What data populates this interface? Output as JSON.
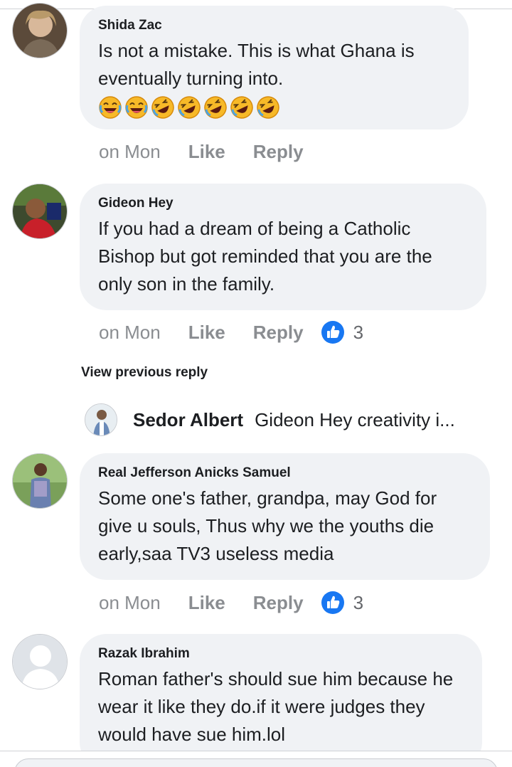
{
  "comments": [
    {
      "author": "Shida Zac",
      "text": "Is not a mistake. This is what Ghana is eventually turning into.",
      "emoji_count": 7,
      "emoji": "laughing-with-tears",
      "time": "on Mon",
      "like_label": "Like",
      "reply_label": "Reply"
    },
    {
      "author": "Gideon Hey",
      "text": "If you had a dream of being a Catholic Bishop but got reminded that you are the only son in the family.",
      "time": "on Mon",
      "like_label": "Like",
      "reply_label": "Reply",
      "reaction_count": "3"
    },
    {
      "author": "Real Jefferson Anicks Samuel",
      "text": "Some one's father, grandpa, may God for give u souls, Thus why we the youths die early,saa TV3 useless media",
      "time": "on Mon",
      "like_label": "Like",
      "reply_label": "Reply",
      "reaction_count": "3"
    },
    {
      "author": "Razak Ibrahim",
      "text": "Roman father's should sue him because he wear it like they do.if it were judges they would have sue him.lol"
    }
  ],
  "view_previous_reply": "View previous reply",
  "reply_preview": {
    "author": "Sedor Albert",
    "text": "Gideon Hey creativity i..."
  },
  "colors": {
    "bubble": "#f0f2f5",
    "muted_text": "#8a8d91",
    "like_blue": "#1877f2",
    "emoji_yellow": "#f7b928"
  },
  "icons": {
    "like_badge": "thumbs-up-icon",
    "emoji": "laughing-emoji-icon"
  }
}
